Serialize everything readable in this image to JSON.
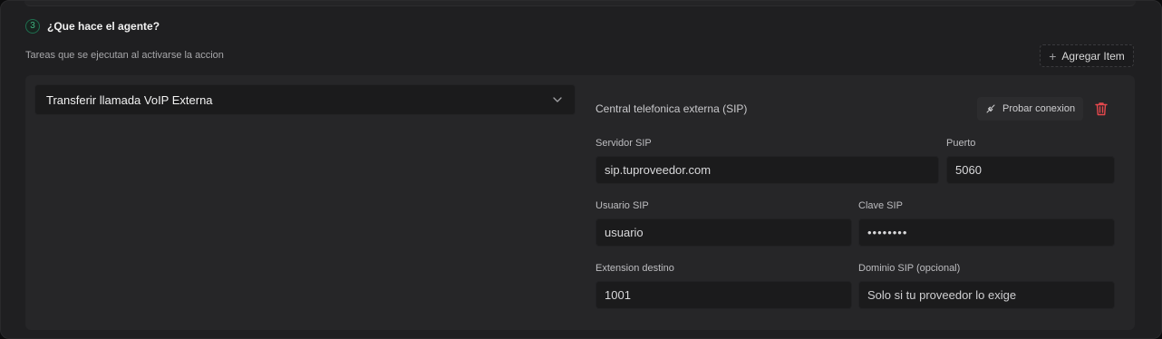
{
  "section": {
    "step_number": "3",
    "title": "¿Que hace el agente?",
    "description": "Tareas que se ejecutan al activarse la accion",
    "add_button_label": "Agregar Item"
  },
  "task": {
    "selected_action": "Transferir llamada VoIP Externa"
  },
  "sip_config": {
    "title": "Central telefonica externa (SIP)",
    "probe_button_label": "Probar conexion",
    "fields": {
      "server_label": "Servidor SIP",
      "server_value": "sip.tuproveedor.com",
      "port_label": "Puerto",
      "port_value": "5060",
      "user_label": "Usuario SIP",
      "user_value": "usuario",
      "password_label": "Clave SIP",
      "password_value": "••••••••",
      "extension_label": "Extension destino",
      "extension_value": "1001",
      "domain_label": "Dominio SIP (opcional)",
      "domain_placeholder": "Solo si tu proveedor lo exige"
    }
  },
  "colors": {
    "accent_green": "#3fb37f",
    "danger_red": "#e5484d"
  },
  "icons": {
    "step": "step-number-badge",
    "add": "plus-icon",
    "dropdown": "chevron-down-icon",
    "probe": "plug-icon",
    "delete": "trash-icon"
  }
}
